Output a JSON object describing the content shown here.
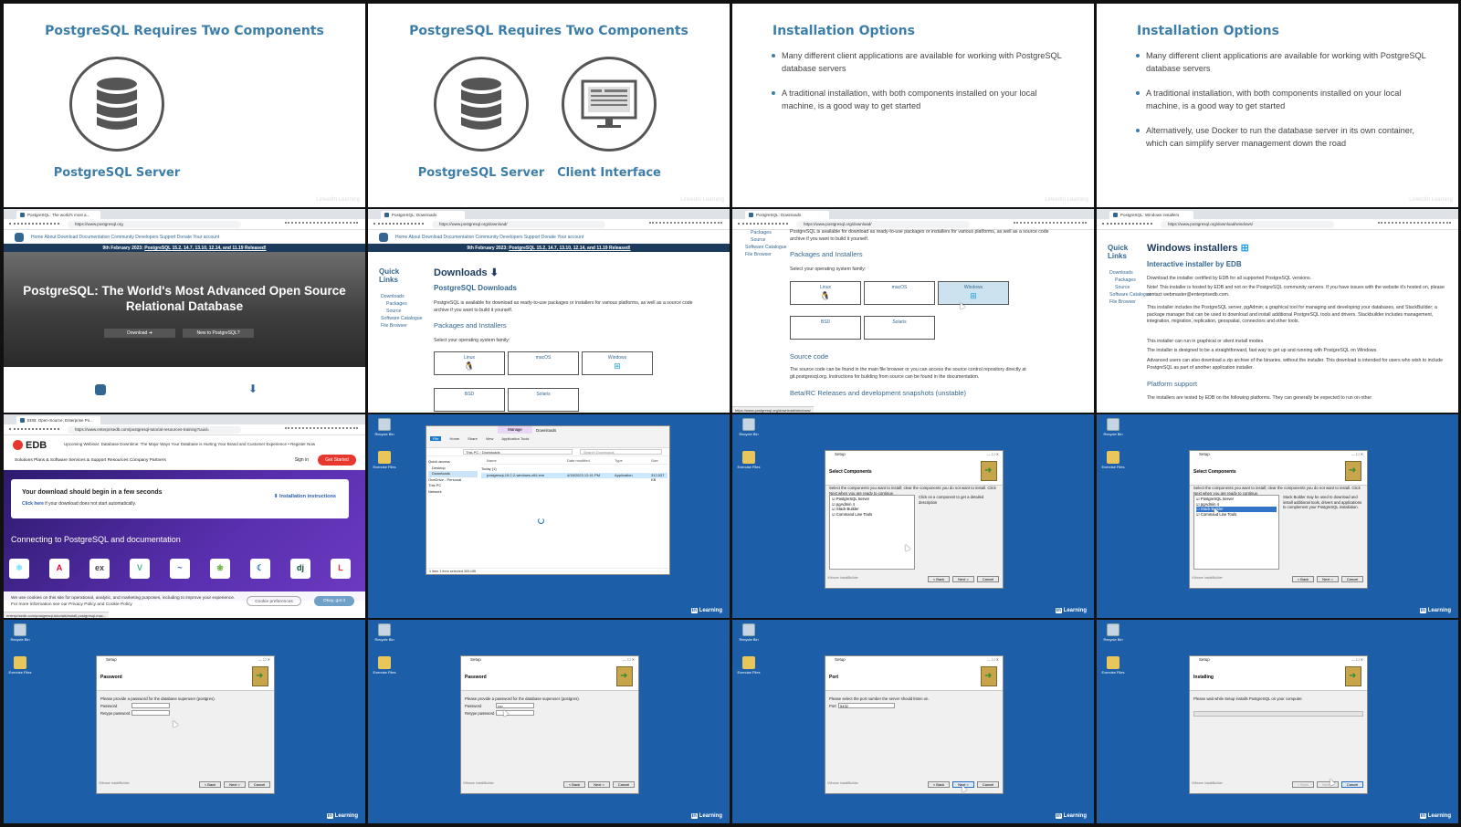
{
  "slides": {
    "components_title": "PostgreSQL Requires Two Components",
    "server_label": "PostgreSQL Server",
    "client_label": "Client Interface",
    "install_title": "Installation Options",
    "bullet1": "Many different client applications are available for working with PostgreSQL database servers",
    "bullet2": "A traditional installation, with both components installed on your local machine, is a good way to get started",
    "bullet3": "Alternatively, use Docker to run the database server in its own container, which can simplify server management down the road",
    "watermark": "LinkedIn Learning"
  },
  "pg_home": {
    "tab": "PostgreSQL: The world's most a...",
    "url": "https://www.postgresql.org",
    "nav": "Home   About   Download   Documentation   Community   Developers   Support   Donate   Your account",
    "banner_date": "9th February 2023:",
    "banner_link": "PostgreSQL 15.2, 14.7, 13.10, 12.14, and 11.19 Released!",
    "hero_title": "PostgreSQL: The World's Most Advanced Open Source Relational Database",
    "download_btn": "Download ➜",
    "new_btn": "New to PostgreSQL?"
  },
  "pg_download": {
    "tab": "PostgreSQL: Downloads",
    "url": "https://www.postgresql.org/download/",
    "quick_links": "Quick Links",
    "ql": [
      "Downloads",
      "Packages",
      "Source",
      "Software Catalogue",
      "File Browser"
    ],
    "downloads": "Downloads",
    "pg_downloads": "PostgreSQL Downloads",
    "intro": "PostgreSQL is available for download as ready-to-use packages or installers for various platforms, as well as a source code archive if you want to build it yourself.",
    "packages": "Packages and Installers",
    "select_os": "Select your operating system family:",
    "os": [
      "Linux",
      "macOS",
      "Windows",
      "BSD",
      "Solaris"
    ],
    "source_code": "Source code",
    "source_text": "The source code can be found in the main file browser or you can access the source control repository directly at git.postgresql.org. Instructions for building from source can be found in the documentation.",
    "beta": "Beta/RC Releases and development snapshots (unstable)",
    "status_url": "https://www.postgresql.org/download/windows/"
  },
  "pg_windows": {
    "tab": "PostgreSQL: Windows installers",
    "url": "https://www.postgresql.org/download/windows/",
    "title": "Windows installers",
    "interactive": "Interactive installer by EDB",
    "p1": "Download the installer certified by EDB for all supported PostgreSQL versions.",
    "p2": "Note! This installer is hosted by EDB and not on the PostgreSQL community servers. If you have issues with the website it's hosted on, please contact webmaster@enterprisedb.com.",
    "p3": "This installer includes the PostgreSQL server, pgAdmin; a graphical tool for managing and developing your databases, and StackBuilder; a package manager that can be used to download and install additional PostgreSQL tools and drivers. Stackbuilder includes management, integration, migration, replication, geospatial, connectors and other tools.",
    "p4": "This installer can run in graphical or silent install modes.",
    "p5": "The installer is designed to be a straightforward, fast way to get up and running with PostgreSQL on Windows.",
    "p6": "Advanced users can also download a zip archive of the binaries, without the installer. This download is intended for users who wish to include PostgreSQL as part of another application installer.",
    "platform": "Platform support",
    "p7": "The installers are tested by EDB on the following platforms. They can generally be expected to run on other"
  },
  "edb": {
    "tab": "EDB: Open-Source, Enterprise Po...",
    "url": "https://www.enterprisedb.com/postgresql-tutorial-resources-training?uuid=",
    "logo": "EDB",
    "webinar": "Upcoming Webinar: Database Downtime: The Major Ways Your Database is Hurting Your Brand and Customer Experience • Register Now",
    "menu": "Solutions    Plans & Software    Services & Support    Resources    Company    Partners",
    "signin": "Sign in",
    "get_started": "Get Started",
    "dl_title": "Your download should begin in a few seconds",
    "click_here": "Click here",
    "dl_rest": " if your download does not start automatically.",
    "install_instr": "Installation instructions",
    "connecting": "Connecting to PostgreSQL and documentation",
    "cookie": "We use cookies on this site for operational, analytic, and marketing purposes, including to improve your experience. For more information see our Privacy Policy and Cookie Policy",
    "cookie_pref": "Cookie preferences",
    "okay": "Okay, got it",
    "status_url": "enterprisedb.com/postgresql-tutorials/install-postgresql-mac..."
  },
  "desktop": {
    "recycle": "Recycle Bin",
    "exercise": "Exercise Files",
    "linkedin": "Learning"
  },
  "explorer": {
    "manage": "Manage",
    "title": "Downloads",
    "tabs": [
      "File",
      "Home",
      "Share",
      "View",
      "Application Tools"
    ],
    "path": "This PC › Downloads",
    "search": "Search Downloads",
    "nav": [
      "Quick access",
      "Desktop",
      "Downloads",
      "OneDrive - Personal",
      "This PC",
      "Network"
    ],
    "col_name": "Name",
    "col_date": "Date modified",
    "col_type": "Type",
    "col_size": "Size",
    "group": "Today (1)",
    "file": "postgresql-15.2-2-windows-x64.exe",
    "file_date": "4/18/2023 12:41 PM",
    "file_type": "Application",
    "file_size": "312,537 KB",
    "status": "1 item     1 item selected  305 MB"
  },
  "setup": {
    "title": "Setup",
    "footer": "VMware InstallBuilder",
    "back": "< Back",
    "next": "Next >",
    "cancel": "Cancel",
    "sel_comp": "Select Components",
    "sel_text": "Select the components you want to install; clear the components you do not want to install. Click Next when you are ready to continue.",
    "components": [
      "PostgreSQL Server",
      "pgAdmin 4",
      "Stack Builder",
      "Command Line Tools"
    ],
    "click_desc": "Click on a component to get a detailed description",
    "sb_desc": "Stack Builder may be used to download and install additional tools, drivers and applications to complement your PostgreSQL installation.",
    "password": "Password",
    "pw_text": "Please provide a password for the database superuser (postgres).",
    "pw_label": "Password",
    "retype": "Retype password",
    "pw_value": "••••",
    "port": "Port",
    "port_text": "Please select the port number the server should listen on.",
    "port_label": "Port",
    "port_value": "5432",
    "installing": "Installing",
    "inst_text": "Please wait while Setup installs PostgreSQL on your computer."
  }
}
